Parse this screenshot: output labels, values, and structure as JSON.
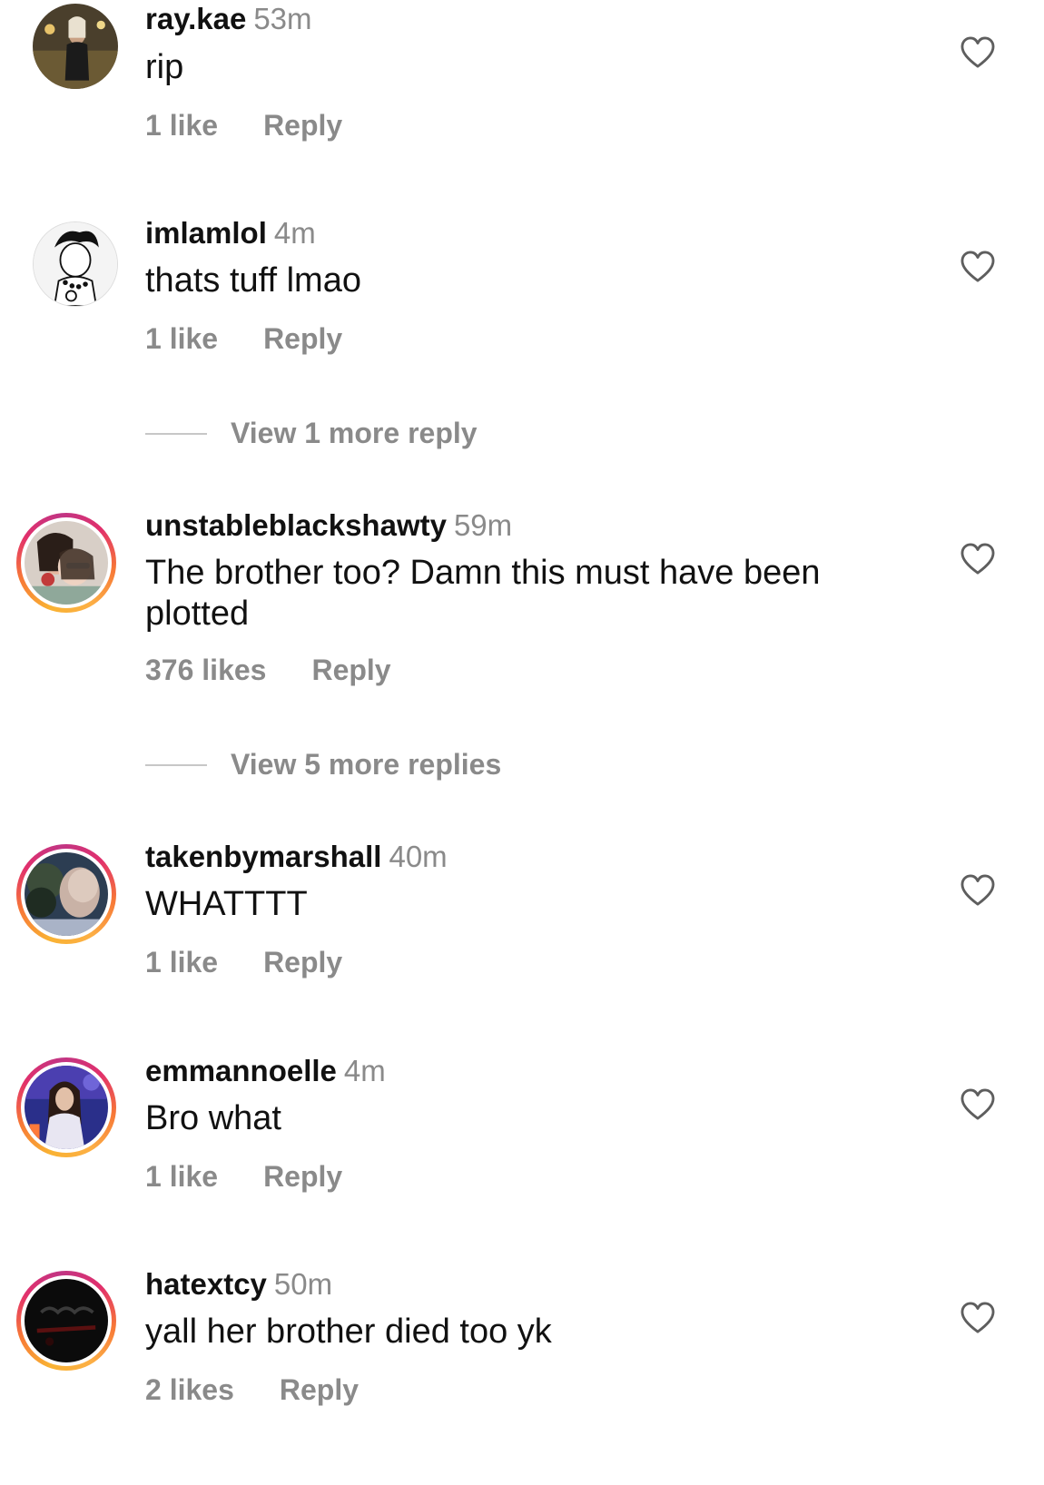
{
  "comments": [
    {
      "username": "ray.kae",
      "time": "53m",
      "text": "rip",
      "likes": "1 like",
      "reply": "Reply",
      "story_ring": false
    },
    {
      "username": "imlamlol",
      "time": "4m",
      "text": "thats tuff lmao",
      "likes": "1 like",
      "reply": "Reply",
      "story_ring": false,
      "view_more": "View 1 more reply"
    },
    {
      "username": "unstableblackshawty",
      "time": "59m",
      "text": "The brother too? Damn this must have been plotted",
      "likes": "376 likes",
      "reply": "Reply",
      "story_ring": true,
      "view_more": "View 5 more replies"
    },
    {
      "username": "takenbymarshall",
      "time": "40m",
      "text": "WHATTTT",
      "likes": "1 like",
      "reply": "Reply",
      "story_ring": true
    },
    {
      "username": "emmannoelle",
      "time": "4m",
      "text": "Bro what",
      "likes": "1 like",
      "reply": "Reply",
      "story_ring": true
    },
    {
      "username": "hatextcy",
      "time": "50m",
      "text": "yall her brother died too yk",
      "likes": "2 likes",
      "reply": "Reply",
      "story_ring": true
    }
  ],
  "icons": {
    "like": "heart-outline-icon"
  },
  "colors": {
    "text": "#111111",
    "secondary": "#8a8a8a",
    "divider": "#c7c7c7"
  }
}
